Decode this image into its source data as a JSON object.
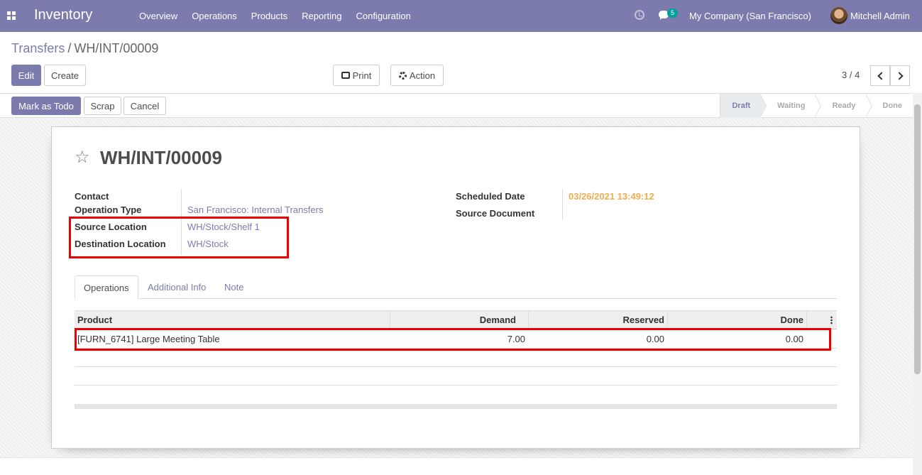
{
  "navbar": {
    "app_name": "Inventory",
    "menu": [
      "Overview",
      "Operations",
      "Products",
      "Reporting",
      "Configuration"
    ],
    "chat_count": "5",
    "company": "My Company (San Francisco)",
    "user": "Mitchell Admin"
  },
  "breadcrumb": {
    "parent": "Transfers",
    "current": "WH/INT/00009"
  },
  "buttons": {
    "edit": "Edit",
    "create": "Create",
    "print": "Print",
    "action": "Action",
    "mark_todo": "Mark as Todo",
    "scrap": "Scrap",
    "cancel": "Cancel"
  },
  "pager": {
    "value": "3 / 4"
  },
  "status": {
    "steps": [
      "Draft",
      "Waiting",
      "Ready",
      "Done"
    ],
    "active": "Draft"
  },
  "record": {
    "name": "WH/INT/00009",
    "fields_left": [
      {
        "label": "Contact",
        "value": ""
      },
      {
        "label": "Operation Type",
        "value": "San Francisco: Internal Transfers"
      },
      {
        "label": "Source Location",
        "value": "WH/Stock/Shelf 1"
      },
      {
        "label": "Destination Location",
        "value": "WH/Stock"
      }
    ],
    "fields_right": [
      {
        "label": "Scheduled Date",
        "value": "03/26/2021 13:49:12"
      },
      {
        "label": "Source Document",
        "value": ""
      }
    ]
  },
  "tabs": [
    "Operations",
    "Additional Info",
    "Note"
  ],
  "table": {
    "columns": [
      "Product",
      "Demand",
      "Reserved",
      "Done"
    ],
    "rows": [
      {
        "product": "[FURN_6741] Large Meeting Table",
        "demand": "7.00",
        "reserved": "0.00",
        "done": "0.00"
      }
    ]
  },
  "colors": {
    "brand": "#7c7bad",
    "highlight": "#e00000",
    "date": "#f0ad4e"
  }
}
